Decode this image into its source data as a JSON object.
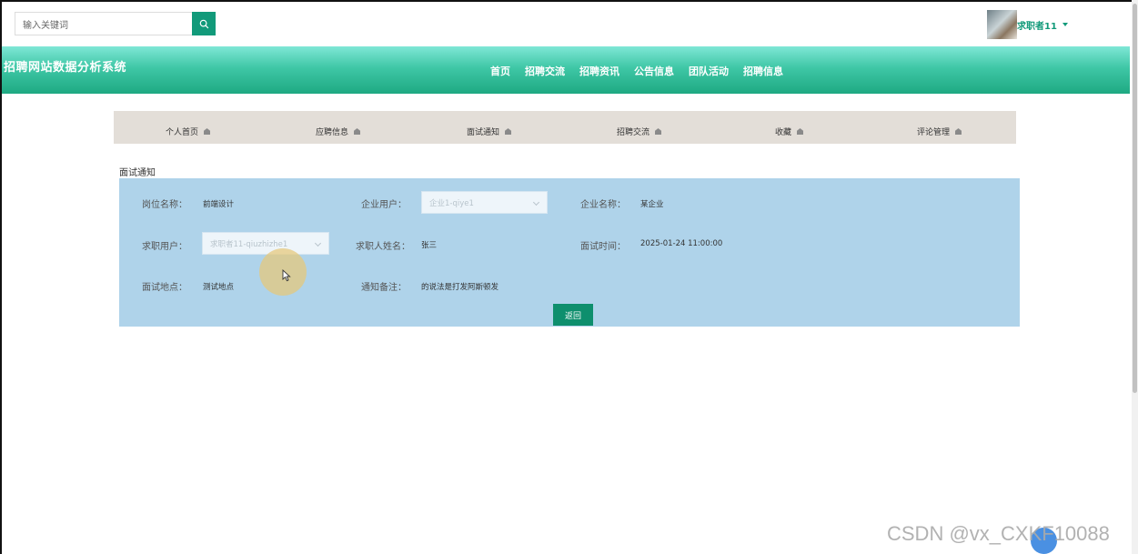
{
  "search": {
    "placeholder": "输入关键词"
  },
  "user": {
    "name": "求职者11"
  },
  "site": {
    "title": "招聘网站数据分析系统"
  },
  "nav": [
    "首页",
    "招聘交流",
    "招聘资讯",
    "公告信息",
    "团队活动",
    "招聘信息"
  ],
  "submenu": [
    "个人首页",
    "应聘信息",
    "面试通知",
    "招聘交流",
    "收藏",
    "评论管理"
  ],
  "section_title": "面试通知",
  "form": {
    "position_label": "岗位名称：",
    "position_value": "前端设计",
    "company_user_label": "企业用户：",
    "company_user_value": "企业1-qiye1",
    "company_name_label": "企业名称：",
    "company_name_value": "某企业",
    "job_user_label": "求职用户：",
    "job_user_value": "求职者11-qiuzhizhe1",
    "applicant_name_label": "求职人姓名：",
    "applicant_name_value": "张三",
    "interview_time_label": "面试时间：",
    "interview_time_value": "2025-01-24 11:00:00",
    "location_label": "面试地点：",
    "location_value": "测试地点",
    "remark_label": "通知备注：",
    "remark_value": "的说法是打发阿斯顿发"
  },
  "back_button": "返回",
  "watermark": "CSDN @vx_CXKF10088",
  "colors": {
    "accent": "#129a7a",
    "panel": "#afd3ea",
    "submenu": "#e3ded8"
  }
}
